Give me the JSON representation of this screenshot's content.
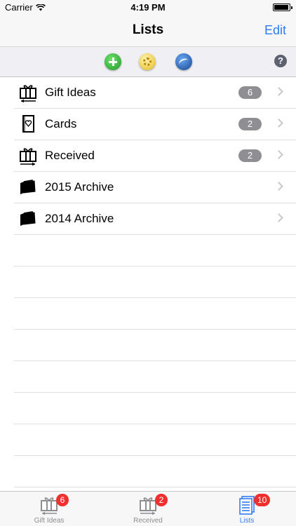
{
  "status_bar": {
    "carrier": "Carrier",
    "time": "4:19 PM"
  },
  "nav": {
    "title": "Lists",
    "edit_label": "Edit"
  },
  "toolbar": {
    "help_label": "?"
  },
  "lists": [
    {
      "label": "Gift Ideas",
      "badge": "6",
      "icon": "gift-out-icon"
    },
    {
      "label": "Cards",
      "badge": "2",
      "icon": "card-icon"
    },
    {
      "label": "Received",
      "badge": "2",
      "icon": "gift-in-icon"
    },
    {
      "label": "2015 Archive",
      "badge": "",
      "icon": "folder-icon"
    },
    {
      "label": "2014 Archive",
      "badge": "",
      "icon": "folder-icon"
    }
  ],
  "tabs": [
    {
      "label": "Gift Ideas",
      "badge": "6",
      "active": false
    },
    {
      "label": "Received",
      "badge": "2",
      "active": false
    },
    {
      "label": "Lists",
      "badge": "10",
      "active": true
    }
  ],
  "colors": {
    "accent": "#2f7bf5",
    "badge_gray": "#8e8e93",
    "badge_red": "#f0302e"
  }
}
